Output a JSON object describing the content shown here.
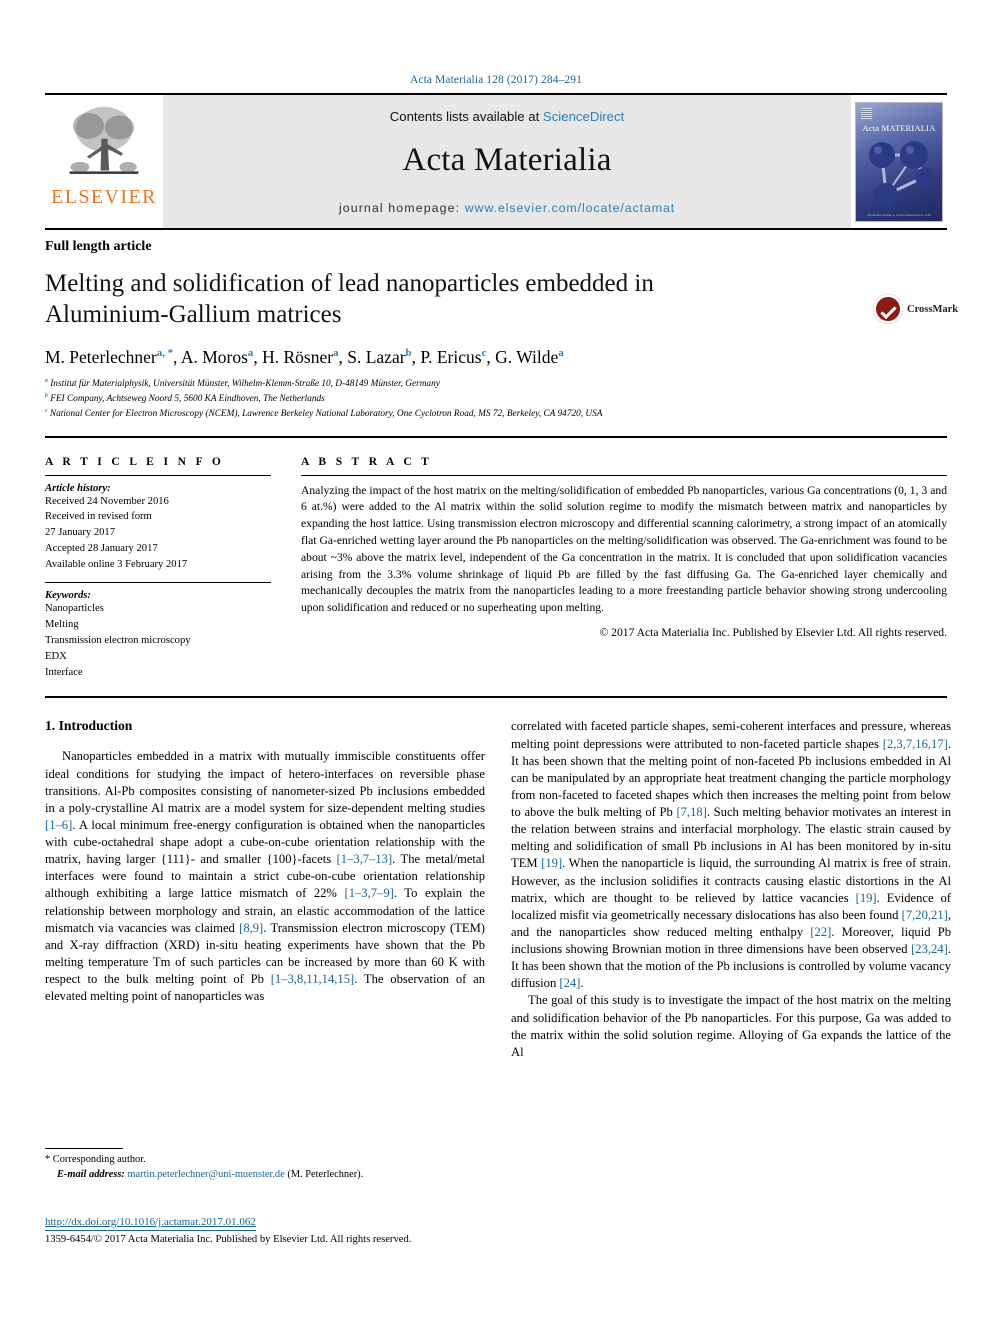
{
  "running_head": "Acta Materialia 128 (2017) 284–291",
  "masthead": {
    "publisher_name": "ELSEVIER",
    "contents_prefix": "Contents lists available at ",
    "contents_link": "ScienceDirect",
    "journal_name": "Acta Materialia",
    "homepage_label": "journal homepage: ",
    "homepage_url": "www.elsevier.com/locate/actamat",
    "cover_title": "Acta MATERIALIA",
    "cover_footer": "Available online at www.sciencedirect.com"
  },
  "article": {
    "category": "Full length article",
    "title": "Melting and solidification of lead nanoparticles embedded in Aluminium-Gallium matrices",
    "authors": [
      {
        "name": "M. Peterlechner",
        "sups": "a, *"
      },
      {
        "name": "A. Moros",
        "sups": "a"
      },
      {
        "name": "H. Rösner",
        "sups": "a"
      },
      {
        "name": "S. Lazar",
        "sups": "b"
      },
      {
        "name": "P. Ericus",
        "sups": "c"
      },
      {
        "name": "G. Wilde",
        "sups": "a"
      }
    ],
    "affiliations": [
      {
        "mark": "a",
        "text": "Institut für Materialphysik, Universität Münster, Wilhelm-Klemm-Straße 10, D-48149 Münster, Germany"
      },
      {
        "mark": "b",
        "text": "FEI Company, Achtseweg Noord 5, 5600 KA Eindhoven, The Netherlands"
      },
      {
        "mark": "c",
        "text": "National Center for Electron Microscopy (NCEM), Lawrence Berkeley National Laboratory, One Cyclotron Road, MS 72, Berkeley, CA 94720, USA"
      }
    ],
    "crossmark_label": "CrossMark"
  },
  "article_info": {
    "heading": "A R T I C L E   I N F O",
    "history_label": "Article history:",
    "history": [
      "Received 24 November 2016",
      "Received in revised form",
      "27 January 2017",
      "Accepted 28 January 2017",
      "Available online 3 February 2017"
    ],
    "keywords_label": "Keywords:",
    "keywords": [
      "Nanoparticles",
      "Melting",
      "Transmission electron microscopy",
      "EDX",
      "Interface"
    ]
  },
  "abstract": {
    "heading": "A B S T R A C T",
    "text": "Analyzing the impact of the host matrix on the melting/solidification of embedded Pb nanoparticles, various Ga concentrations (0, 1, 3 and 6 at.%) were added to the Al matrix within the solid solution regime to modify the mismatch between matrix and nanoparticles by expanding the host lattice. Using transmission electron microscopy and differential scanning calorimetry, a strong impact of an atomically flat Ga-enriched wetting layer around the Pb nanoparticles on the melting/solidification was observed. The Ga-enrichment was found to be about ~3% above the matrix level, independent of the Ga concentration in the matrix. It is concluded that upon solidification vacancies arising from the 3.3% volume shrinkage of liquid Pb are filled by the fast diffusing Ga. The Ga-enriched layer chemically and mechanically decouples the matrix from the nanoparticles leading to a more freestanding particle behavior showing strong undercooling upon solidification and reduced or no superheating upon melting.",
    "copyright": "© 2017 Acta Materialia Inc. Published by Elsevier Ltd. All rights reserved."
  },
  "body": {
    "section_heading": "1. Introduction",
    "left_paragraphs": [
      "Nanoparticles embedded in a matrix with mutually immiscible constituents offer ideal conditions for studying the impact of hetero-interfaces on reversible phase transitions. Al-Pb composites consisting of nanometer-sized Pb inclusions embedded in a poly-crystalline Al matrix are a model system for size-dependent melting studies [1–6]. A local minimum free-energy configuration is obtained when the nanoparticles with cube-octahedral shape adopt a cube-on-cube orientation relationship with the matrix, having larger {111}- and smaller {100}-facets [1–3,7–13]. The metal/metal interfaces were found to maintain a strict cube-on-cube orientation relationship although exhibiting a large lattice mismatch of 22% [1–3,7–9]. To explain the relationship between morphology and strain, an elastic accommodation of the lattice mismatch via vacancies was claimed [8,9]. Transmission electron microscopy (TEM) and X-ray diffraction (XRD) in-situ heating experiments have shown that the Pb melting temperature Tm of such particles can be increased by more than 60 K with respect to the bulk melting point of Pb [1–3,8,11,14,15]. The observation of an elevated melting point of nanoparticles was"
    ],
    "right_paragraphs": [
      "correlated with faceted particle shapes, semi-coherent interfaces and pressure, whereas melting point depressions were attributed to non-faceted particle shapes [2,3,7,16,17]. It has been shown that the melting point of non-faceted Pb inclusions embedded in Al can be manipulated by an appropriate heat treatment changing the particle morphology from non-faceted to faceted shapes which then increases the melting point from below to above the bulk melting of Pb [7,18]. Such melting behavior motivates an interest in the relation between strains and interfacial morphology. The elastic strain caused by melting and solidification of small Pb inclusions in Al has been monitored by in-situ TEM [19]. When the nanoparticle is liquid, the surrounding Al matrix is free of strain. However, as the inclusion solidifies it contracts causing elastic distortions in the Al matrix, which are thought to be relieved by lattice vacancies [19]. Evidence of localized misfit via geometrically necessary dislocations has also been found [7,20,21], and the nanoparticles show reduced melting enthalpy [22]. Moreover, liquid Pb inclusions showing Brownian motion in three dimensions have been observed [23,24]. It has been shown that the motion of the Pb inclusions is controlled by volume vacancy diffusion [24].",
      "The goal of this study is to investigate the impact of the host matrix on the melting and solidification behavior of the Pb nanoparticles. For this purpose, Ga was added to the matrix within the solid solution regime. Alloying of Ga expands the lattice of the Al"
    ]
  },
  "footnote": {
    "corresponding": "* Corresponding author.",
    "email_label": "E-mail address:",
    "email": "martin.peterlechner@uni-muenster.de",
    "email_suffix": "(M. Peterlechner)."
  },
  "footer": {
    "doi": "http://dx.doi.org/10.1016/j.actamat.2017.01.062",
    "copyright": "1359-6454/© 2017 Acta Materialia Inc. Published by Elsevier Ltd. All rights reserved."
  }
}
